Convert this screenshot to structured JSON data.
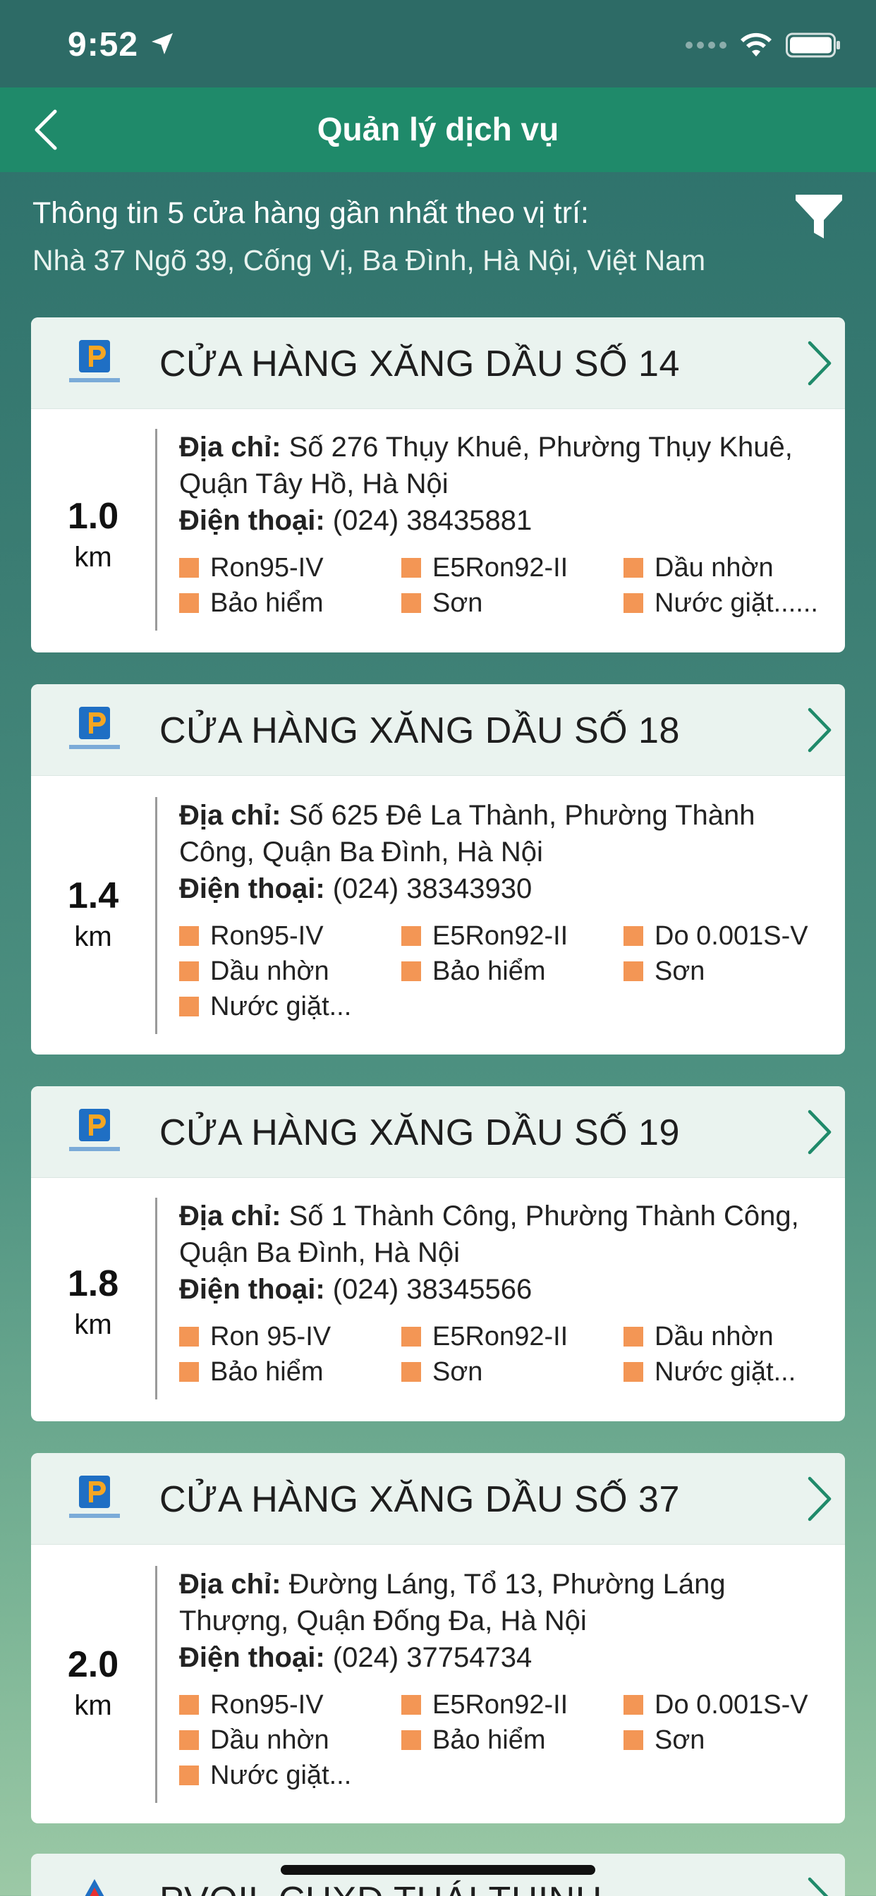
{
  "status_bar": {
    "time": "9:52"
  },
  "nav": {
    "title": "Quản lý dịch vụ"
  },
  "info": {
    "title": "Thông tin 5 cửa hàng gần nhất theo vị trí:",
    "address": "Nhà 37 Ngõ 39, Cống Vị, Ba Đình, Hà Nội, Việt Nam"
  },
  "labels": {
    "address": "Địa chỉ:",
    "phone": "Điện thoại:"
  },
  "stores": [
    {
      "name": "CỬA HÀNG XĂNG DẦU SỐ 14",
      "distance": "1.0",
      "unit": "km",
      "address_line1": "Số 276 Thụy Khuê, Phường Thụy Khuê,",
      "address_line2": "Quận Tây Hồ, Hà Nội",
      "phone": "(024) 38435881",
      "services": [
        "Ron95-IV",
        "E5Ron92-II",
        " Dầu nhờn",
        "Bảo hiểm",
        "Sơn",
        "Nước giặt......"
      ]
    },
    {
      "name": "CỬA HÀNG XĂNG DẦU SỐ 18",
      "distance": "1.4",
      "unit": "km",
      "address_line1": "Số 625 Đê La Thành, Phường Thành",
      "address_line2": "Công, Quận Ba Đình, Hà Nội",
      "phone": "(024) 38343930",
      "services": [
        "Ron95-IV",
        "E5Ron92-II",
        " Do 0.001S-V",
        "Dầu nhờn",
        "Bảo hiểm",
        "Sơn",
        "Nước giặt..."
      ]
    },
    {
      "name": "CỬA HÀNG XĂNG DẦU SỐ 19",
      "distance": "1.8",
      "unit": "km",
      "address_line1": "Số 1 Thành Công, Phường Thành Công,",
      "address_line2": "Quận Ba Đình, Hà Nội",
      "phone": "(024) 38345566",
      "services": [
        "Ron 95-IV",
        "E5Ron92-II",
        " Dầu nhờn",
        "Bảo hiểm",
        "Sơn",
        "Nước giặt..."
      ]
    },
    {
      "name": "CỬA HÀNG XĂNG DẦU SỐ 37",
      "distance": "2.0",
      "unit": "km",
      "address_line1": "Đường Láng, Tổ 13, Phường Láng",
      "address_line2": "Thượng, Quận Đống Đa, Hà Nội",
      "phone": "(024) 37754734",
      "services": [
        "Ron95-IV",
        " E5Ron92-II",
        "Do 0.001S-V",
        "Dầu nhờn",
        "Bảo hiểm",
        "Sơn",
        "Nước giặt..."
      ]
    },
    {
      "name": "PVOIL CHXD THÁI THỊNH"
    }
  ],
  "colors": {
    "nav": "#1f8a6a",
    "service_square": "#f39655",
    "card_header": "#eaf3ef",
    "chevron": "#1f8a6a"
  }
}
